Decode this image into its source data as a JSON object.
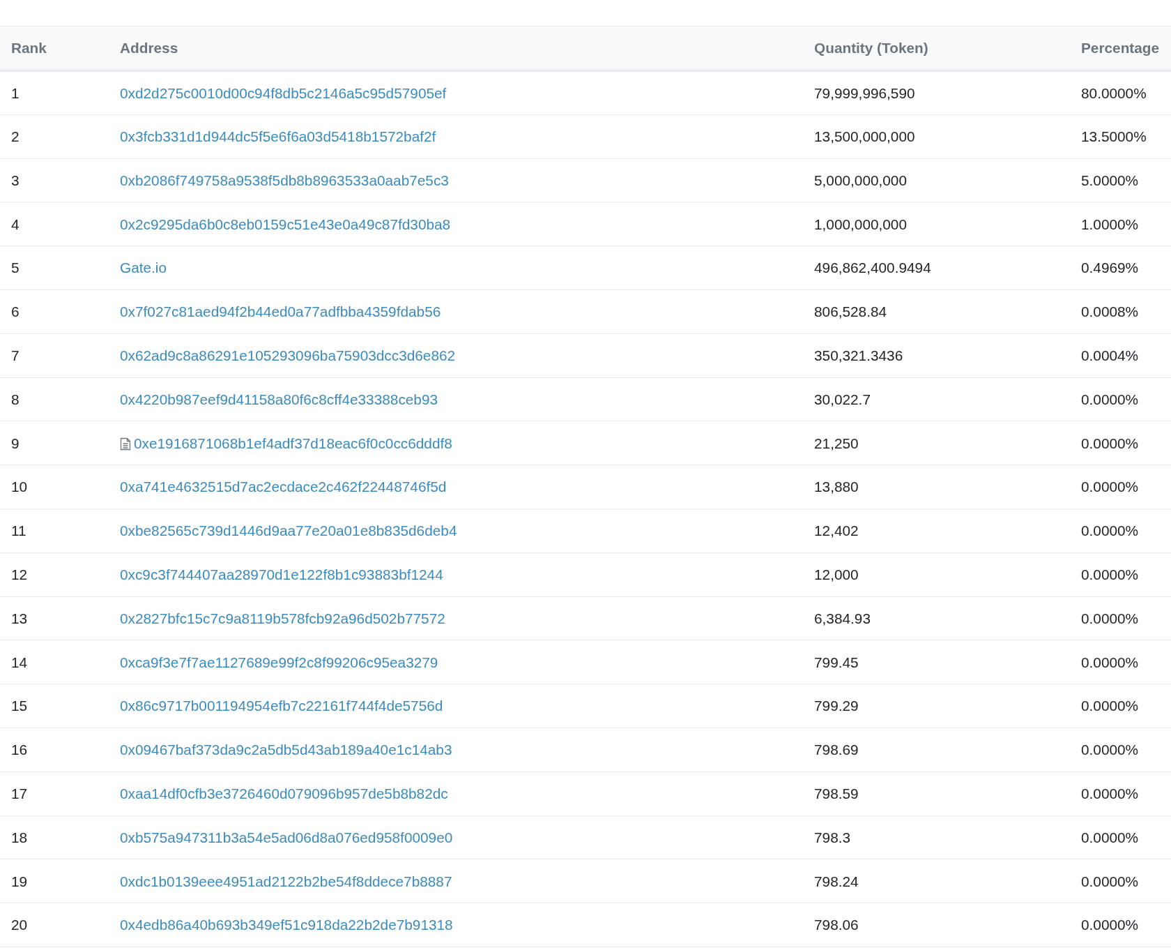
{
  "table": {
    "columns": [
      "Rank",
      "Address",
      "Quantity (Token)",
      "Percentage"
    ],
    "rows": [
      {
        "rank": "1",
        "address": "0xd2d275c0010d00c94f8db5c2146a5c95d57905ef",
        "contract": false,
        "quantity": "79,999,996,590",
        "percentage": "80.0000%"
      },
      {
        "rank": "2",
        "address": "0x3fcb331d1d944dc5f5e6f6a03d5418b1572baf2f",
        "contract": false,
        "quantity": "13,500,000,000",
        "percentage": "13.5000%"
      },
      {
        "rank": "3",
        "address": "0xb2086f749758a9538f5db8b8963533a0aab7e5c3",
        "contract": false,
        "quantity": "5,000,000,000",
        "percentage": "5.0000%"
      },
      {
        "rank": "4",
        "address": "0x2c9295da6b0c8eb0159c51e43e0a49c87fd30ba8",
        "contract": false,
        "quantity": "1,000,000,000",
        "percentage": "1.0000%"
      },
      {
        "rank": "5",
        "address": "Gate.io",
        "contract": false,
        "quantity": "496,862,400.9494",
        "percentage": "0.4969%"
      },
      {
        "rank": "6",
        "address": "0x7f027c81aed94f2b44ed0a77adfbba4359fdab56",
        "contract": false,
        "quantity": "806,528.84",
        "percentage": "0.0008%"
      },
      {
        "rank": "7",
        "address": "0x62ad9c8a86291e105293096ba75903dcc3d6e862",
        "contract": false,
        "quantity": "350,321.3436",
        "percentage": "0.0004%"
      },
      {
        "rank": "8",
        "address": "0x4220b987eef9d41158a80f6c8cff4e33388ceb93",
        "contract": false,
        "quantity": "30,022.7",
        "percentage": "0.0000%"
      },
      {
        "rank": "9",
        "address": "0xe1916871068b1ef4adf37d18eac6f0c0cc6dddf8",
        "contract": true,
        "quantity": "21,250",
        "percentage": "0.0000%"
      },
      {
        "rank": "10",
        "address": "0xa741e4632515d7ac2ecdace2c462f22448746f5d",
        "contract": false,
        "quantity": "13,880",
        "percentage": "0.0000%"
      },
      {
        "rank": "11",
        "address": "0xbe82565c739d1446d9aa77e20a01e8b835d6deb4",
        "contract": false,
        "quantity": "12,402",
        "percentage": "0.0000%"
      },
      {
        "rank": "12",
        "address": "0xc9c3f744407aa28970d1e122f8b1c93883bf1244",
        "contract": false,
        "quantity": "12,000",
        "percentage": "0.0000%"
      },
      {
        "rank": "13",
        "address": "0x2827bfc15c7c9a8119b578fcb92a96d502b77572",
        "contract": false,
        "quantity": "6,384.93",
        "percentage": "0.0000%"
      },
      {
        "rank": "14",
        "address": "0xca9f3e7f7ae1127689e99f2c8f99206c95ea3279",
        "contract": false,
        "quantity": "799.45",
        "percentage": "0.0000%"
      },
      {
        "rank": "15",
        "address": "0x86c9717b001194954efb7c22161f744f4de5756d",
        "contract": false,
        "quantity": "799.29",
        "percentage": "0.0000%"
      },
      {
        "rank": "16",
        "address": "0x09467baf373da9c2a5db5d43ab189a40e1c14ab3",
        "contract": false,
        "quantity": "798.69",
        "percentage": "0.0000%"
      },
      {
        "rank": "17",
        "address": "0xaa14df0cfb3e3726460d079096b957de5b8b82dc",
        "contract": false,
        "quantity": "798.59",
        "percentage": "0.0000%"
      },
      {
        "rank": "18",
        "address": "0xb575a947311b3a54e5ad06d8a076ed958f0009e0",
        "contract": false,
        "quantity": "798.3",
        "percentage": "0.0000%"
      },
      {
        "rank": "19",
        "address": "0xdc1b0139eee4951ad2122b2be54f8ddece7b8887",
        "contract": false,
        "quantity": "798.24",
        "percentage": "0.0000%"
      },
      {
        "rank": "20",
        "address": "0x4edb86a40b693b349ef51c918da22b2de7b91318",
        "contract": false,
        "quantity": "798.06",
        "percentage": "0.0000%"
      }
    ]
  }
}
